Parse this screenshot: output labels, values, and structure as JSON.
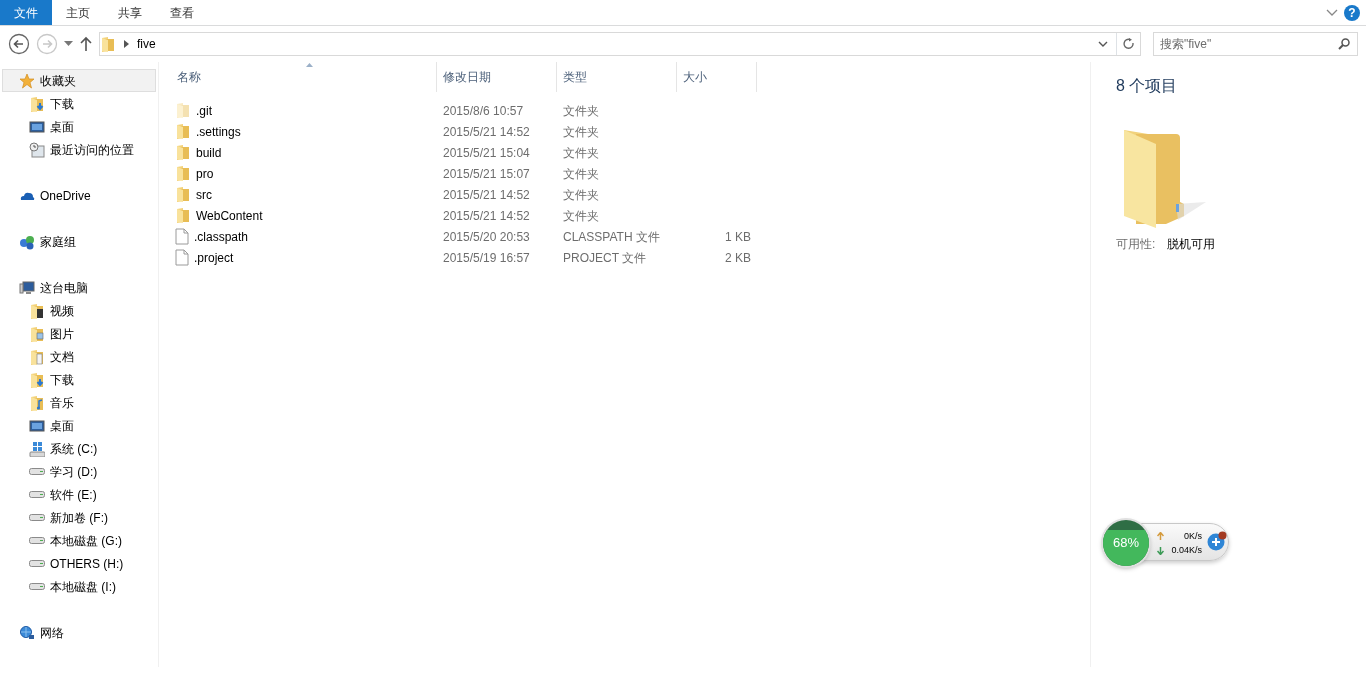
{
  "ribbon": {
    "tabs": [
      {
        "label": "文件",
        "selected": true
      },
      {
        "label": "主页",
        "selected": false
      },
      {
        "label": "共享",
        "selected": false
      },
      {
        "label": "查看",
        "selected": false
      }
    ],
    "help": "?"
  },
  "address": {
    "path": [
      "five"
    ],
    "search": {
      "placeholder": "搜索\"five\""
    }
  },
  "sidebar": {
    "groups": [
      {
        "label": "收藏夹",
        "kind": "star",
        "selected": true,
        "children": [
          {
            "label": "下载",
            "kind": "download",
            "selected": false
          },
          {
            "label": "桌面",
            "kind": "desktop",
            "selected": false
          },
          {
            "label": "最近访问的位置",
            "kind": "recent",
            "selected": false
          }
        ]
      },
      {
        "label": "OneDrive",
        "kind": "cloud",
        "selected": false
      },
      {
        "label": "家庭组",
        "kind": "homegroup",
        "selected": false
      },
      {
        "label": "这台电脑",
        "kind": "pc",
        "selected": false,
        "children": [
          {
            "label": "视频",
            "kind": "video",
            "selected": false
          },
          {
            "label": "图片",
            "kind": "picture",
            "selected": false
          },
          {
            "label": "文档",
            "kind": "document",
            "selected": false
          },
          {
            "label": "下载",
            "kind": "download",
            "selected": false
          },
          {
            "label": "音乐",
            "kind": "music",
            "selected": false
          },
          {
            "label": "桌面",
            "kind": "desktop",
            "selected": false
          },
          {
            "label": "系统 (C:)",
            "kind": "sysdrive",
            "selected": false
          },
          {
            "label": "学习 (D:)",
            "kind": "drive",
            "selected": false
          },
          {
            "label": "软件 (E:)",
            "kind": "drive",
            "selected": false
          },
          {
            "label": "新加卷 (F:)",
            "kind": "drive",
            "selected": false
          },
          {
            "label": "本地磁盘 (G:)",
            "kind": "drive",
            "selected": false
          },
          {
            "label": "OTHERS (H:)",
            "kind": "drive",
            "selected": false
          },
          {
            "label": "本地磁盘 (I:)",
            "kind": "drive",
            "selected": false
          }
        ]
      },
      {
        "label": "网络",
        "kind": "network",
        "selected": false
      }
    ]
  },
  "file_list": {
    "columns": [
      {
        "label": "名称",
        "sorted": true
      },
      {
        "label": "修改日期",
        "sorted": false
      },
      {
        "label": "类型",
        "sorted": false
      },
      {
        "label": "大小",
        "sorted": false
      }
    ],
    "rows": [
      {
        "name": ".git",
        "modified": "2015/8/6 10:57",
        "type": "文件夹",
        "kind": "folder",
        "hidden": true
      },
      {
        "name": ".settings",
        "modified": "2015/5/21 14:52",
        "type": "文件夹",
        "kind": "folder",
        "hidden": false
      },
      {
        "name": "build",
        "modified": "2015/5/21 15:04",
        "type": "文件夹",
        "kind": "folder",
        "hidden": false
      },
      {
        "name": "pro",
        "modified": "2015/5/21 15:07",
        "type": "文件夹",
        "kind": "folder",
        "hidden": false
      },
      {
        "name": "src",
        "modified": "2015/5/21 14:52",
        "type": "文件夹",
        "kind": "folder",
        "hidden": false
      },
      {
        "name": "WebContent",
        "modified": "2015/5/21 14:52",
        "type": "文件夹",
        "kind": "folder",
        "hidden": false
      },
      {
        "name": ".classpath",
        "modified": "2015/5/20 20:53",
        "type": "CLASSPATH 文件",
        "size": "1 KB",
        "kind": "file",
        "hidden": false
      },
      {
        "name": ".project",
        "modified": "2015/5/19 16:57",
        "type": "PROJECT 文件",
        "size": "2 KB",
        "kind": "file",
        "hidden": false
      }
    ]
  },
  "details": {
    "count": "8 个项目",
    "property_label": "可用性:",
    "property_value": "脱机可用"
  },
  "network_widget": {
    "percent": "68%",
    "upload": "0K/s",
    "download": "0.04K/s"
  }
}
